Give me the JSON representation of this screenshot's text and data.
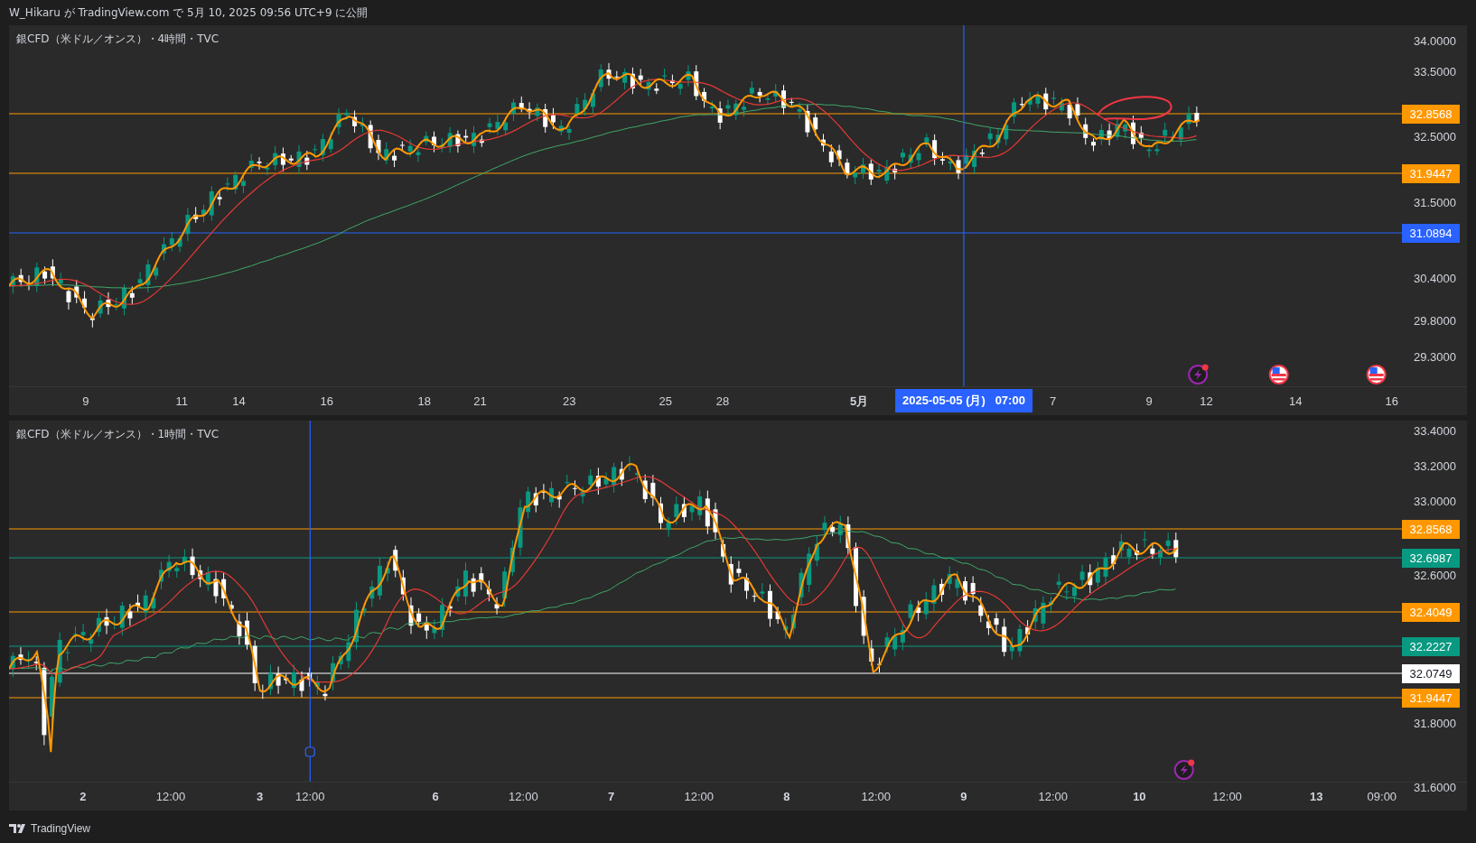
{
  "header": {
    "text": "W_Hikaru が TradingView.com で 5月 10, 2025 09:56 UTC+9 に公開"
  },
  "panels": [
    {
      "title": "銀CFD（米ドル／オンス）・4時間・TVC",
      "y_ticks": [
        "34.0000",
        "33.5000",
        "32.5000",
        "31.5000",
        "30.4000",
        "29.8000",
        "29.3000"
      ],
      "price_labels": [
        {
          "text": "32.8568",
          "color": "#ff9800"
        },
        {
          "text": "31.9447",
          "color": "#ff9800"
        },
        {
          "text": "31.0894",
          "color": "#2962ff"
        }
      ],
      "x_labels": [
        {
          "text": "9",
          "bold": false
        },
        {
          "text": "11",
          "bold": false
        },
        {
          "text": "14",
          "bold": false
        },
        {
          "text": "16",
          "bold": false
        },
        {
          "text": "18",
          "bold": false
        },
        {
          "text": "21",
          "bold": false
        },
        {
          "text": "23",
          "bold": false
        },
        {
          "text": "25",
          "bold": false
        },
        {
          "text": "28",
          "bold": false
        },
        {
          "text": "5月",
          "bold": true
        },
        {
          "text": "7",
          "bold": false
        },
        {
          "text": "9",
          "bold": false
        },
        {
          "text": "12",
          "bold": false
        },
        {
          "text": "14",
          "bold": false
        },
        {
          "text": "16",
          "bold": false
        }
      ],
      "crosshair_label": "2025-05-05 (月)   07:00"
    },
    {
      "title": "銀CFD（米ドル／オンス）・1時間・TVC",
      "y_ticks": [
        "33.4000",
        "33.2000",
        "33.0000",
        "32.6000",
        "31.8000",
        "31.6000"
      ],
      "price_labels": [
        {
          "text": "32.8568",
          "color": "#ff9800"
        },
        {
          "text": "32.6987",
          "color": "#089981"
        },
        {
          "text": "32.4049",
          "color": "#ff9800"
        },
        {
          "text": "32.2227",
          "color": "#089981"
        },
        {
          "text": "32.0749",
          "color": "#ffffff"
        },
        {
          "text": "31.9447",
          "color": "#ff9800"
        }
      ],
      "x_labels": [
        {
          "text": "2",
          "bold": true
        },
        {
          "text": "12:00",
          "bold": false
        },
        {
          "text": "3",
          "bold": true
        },
        {
          "text": "12:00",
          "bold": false
        },
        {
          "text": "6",
          "bold": true
        },
        {
          "text": "12:00",
          "bold": false
        },
        {
          "text": "7",
          "bold": true
        },
        {
          "text": "12:00",
          "bold": false
        },
        {
          "text": "8",
          "bold": true
        },
        {
          "text": "12:00",
          "bold": false
        },
        {
          "text": "9",
          "bold": true
        },
        {
          "text": "12:00",
          "bold": false
        },
        {
          "text": "10",
          "bold": true
        },
        {
          "text": "12:00",
          "bold": false
        },
        {
          "text": "13",
          "bold": true
        },
        {
          "text": "09:00",
          "bold": false
        }
      ]
    }
  ],
  "footer": {
    "brand": "TradingView"
  }
}
